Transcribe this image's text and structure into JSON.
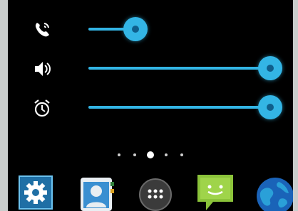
{
  "volume_panel": {
    "rows": [
      {
        "id": "ringtone",
        "icon": "phone-ring-icon",
        "level": 0.26
      },
      {
        "id": "media",
        "icon": "speaker-volume-icon",
        "level": 1.0
      },
      {
        "id": "alarm",
        "icon": "alarm-clock-icon",
        "level": 1.0
      }
    ],
    "accent": "#33b5e5"
  },
  "home_pages": {
    "count": 5,
    "current": 3
  },
  "dock": {
    "apps": [
      {
        "name": "settings",
        "icon": "settings-icon"
      },
      {
        "name": "contacts",
        "icon": "contacts-icon"
      },
      {
        "name": "app-drawer",
        "icon": "app-drawer-icon"
      },
      {
        "name": "messaging",
        "icon": "messaging-icon"
      },
      {
        "name": "browser",
        "icon": "browser-globe-icon"
      }
    ]
  }
}
